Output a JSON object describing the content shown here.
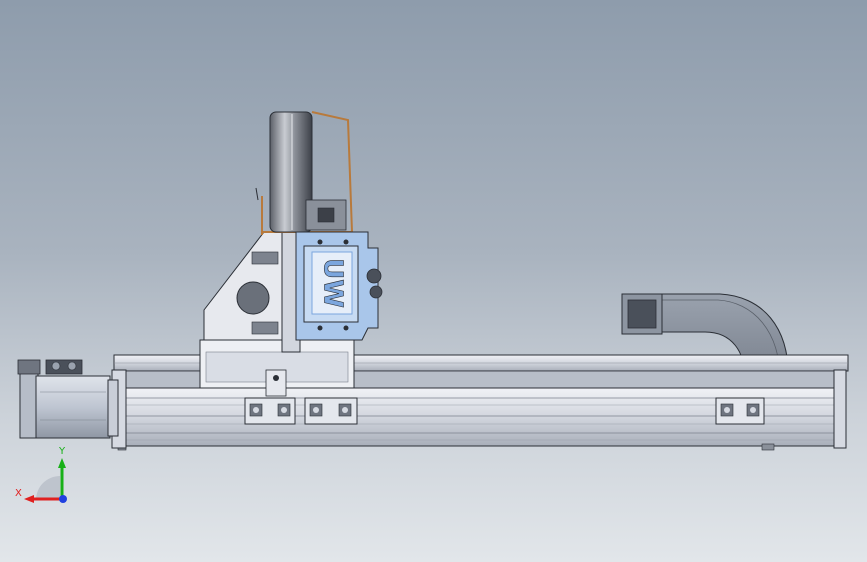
{
  "view": {
    "type": "cad-3d-viewport",
    "background_top": "#8e9cac",
    "background_bottom": "#e2e6ea"
  },
  "model": {
    "carriage_plate_logo": "UW",
    "parts": [
      "servo-motor",
      "linear-rail-base",
      "linear-guide-rail",
      "guide-blocks",
      "carriage-base",
      "triangular-bracket",
      "upright-plate",
      "end-effector-housing",
      "disc-wheel",
      "wire-guard",
      "cable-chain",
      "rail-end-plates",
      "mounting-feet"
    ],
    "colors": {
      "metal_light": "#e6e8ee",
      "metal_mid": "#c7cbd4",
      "metal_dark": "#6f7580",
      "anodized_blue": "#a9c6ea",
      "blue_highlight": "#7ba6de",
      "outline": "#2b2f36",
      "copper": "#b87a3c"
    }
  },
  "triad": {
    "x_label": "X",
    "y_label": "Y",
    "x_color": "#e02020",
    "y_color": "#18b018",
    "z_color": "#2040e0"
  }
}
